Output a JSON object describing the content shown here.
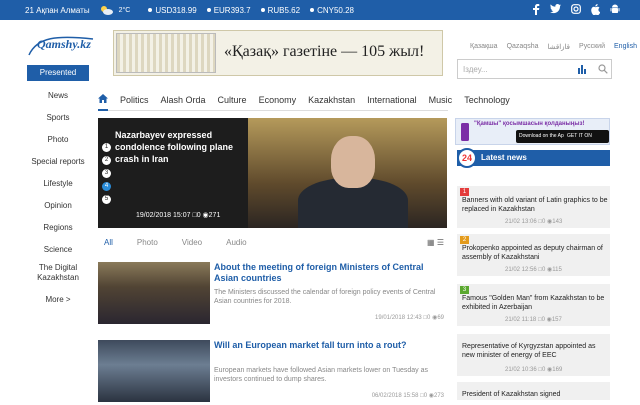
{
  "topbar": {
    "date": "21 Ақпан Алматы",
    "temp": "2°C",
    "rates": [
      "USD318.99",
      "EUR393.7",
      "RUB5.62",
      "CNY50.28"
    ]
  },
  "logo": {
    "text": "Qamshy.kz"
  },
  "banner": {
    "text": "«Қазақ» газетіне — 105 жыл!"
  },
  "langs": [
    "Қазақша",
    "Qazaqsha",
    "قازاقشا",
    "Русский",
    "English"
  ],
  "search": {
    "placeholder": "Іздеу..."
  },
  "sidebar": {
    "presented": "Presented",
    "items": [
      "News",
      "Sports",
      "Photo",
      "Special reports",
      "Lifestyle",
      "Opinion",
      "Regions",
      "Science",
      "The Digital Kazakhstan",
      "More >"
    ]
  },
  "nav": [
    "Politics",
    "Alash Orda",
    "Culture",
    "Economy",
    "Kazakhstan",
    "International",
    "Music",
    "Technology"
  ],
  "feature": {
    "title": "Nazarbayev expressed condolence following plane crash in Iran",
    "nums": [
      "1",
      "2",
      "3",
      "4",
      "5"
    ],
    "selected": 4,
    "date": "19/02/2018 15:07",
    "comments": "0",
    "views": "271"
  },
  "filters": [
    "All",
    "Photo",
    "Video",
    "Audio"
  ],
  "articles": [
    {
      "title": "About the meeting of foreign Ministers of Central Asian countries",
      "desc": "The Ministers discussed the calendar of foreign policy events of Central Asian countries for 2018.",
      "date": "19/01/2018 12:43",
      "comments": "0",
      "views": "69"
    },
    {
      "title": "Will an European market fall turn into a rout?",
      "desc": "European markets have followed Asian markets lower on Tuesday as investors continued to dump shares.",
      "date": "06/02/2018 15:58",
      "comments": "0",
      "views": "273"
    }
  ],
  "promo": {
    "text": "\"Қамшы\" қосымшасын қолданыңыз!",
    "appstore": "Download on the App Store",
    "googleplay": "GET IT ON Google Play"
  },
  "latest": {
    "badge": "24",
    "title": "Latest news",
    "items": [
      {
        "num": "1",
        "text": "Banners with old variant of Latin graphics to be replaced in Kazakhstan",
        "date": "21/02 13:06",
        "comments": "0",
        "views": "143",
        "color": "#e33b3b"
      },
      {
        "num": "2",
        "text": "Prokopenko appointed as deputy chairman of assembly of Kazakhstani",
        "date": "21/02 12:56",
        "comments": "0",
        "views": "115",
        "color": "#e39a1b"
      },
      {
        "num": "3",
        "text": "Famous \"Golden Man\" from Kazakhstan to be exhibited in Azerbaijan",
        "date": "21/02 11:18",
        "comments": "0",
        "views": "157",
        "color": "#5aa82f"
      },
      {
        "num": "",
        "text": "Representative of Kyrgyzstan appointed as new minister of energy of EEC",
        "date": "21/02 10:36",
        "comments": "0",
        "views": "169",
        "color": ""
      },
      {
        "num": "",
        "text": "President of Kazakhstan signed",
        "date": "",
        "comments": "",
        "views": "",
        "color": ""
      }
    ]
  }
}
